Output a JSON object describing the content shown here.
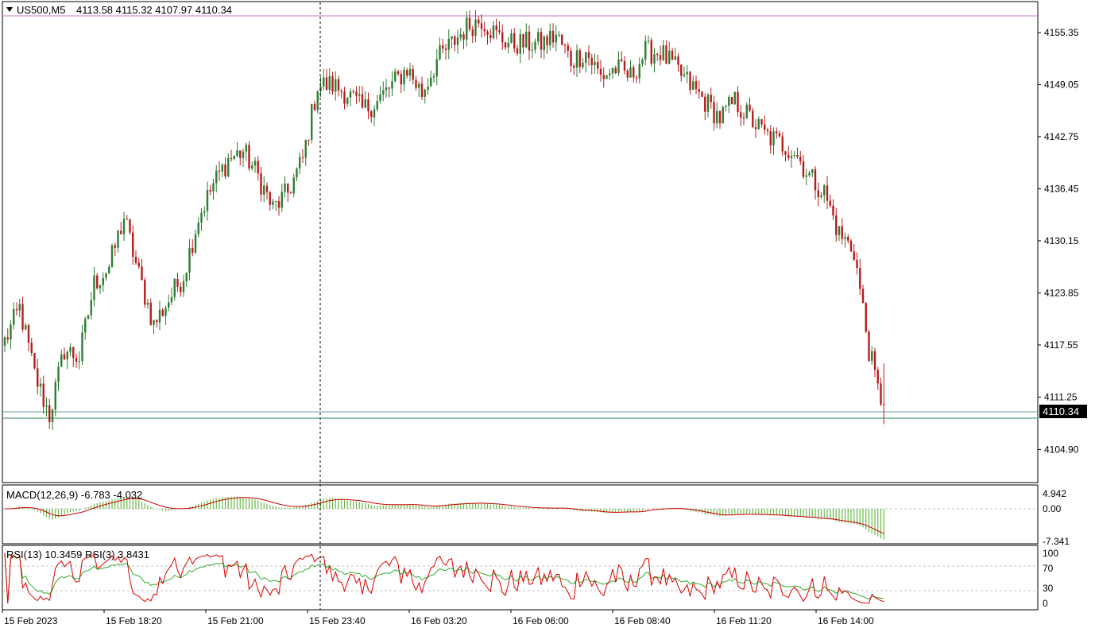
{
  "header": {
    "symbol": "US500,M5",
    "ohlc": "4113.58 4115.32 4107.97 4110.34"
  },
  "price_axis": {
    "ticks": [
      "4155.35",
      "4149.05",
      "4142.75",
      "4136.45",
      "4130.15",
      "4123.85",
      "4117.55",
      "4111.25",
      "4104.90"
    ],
    "current_price": "4110.34"
  },
  "time_axis": {
    "labels": [
      "15 Feb 2023",
      "15 Feb 18:20",
      "15 Feb 21:00",
      "15 Feb 23:40",
      "16 Feb 03:20",
      "16 Feb 06:00",
      "16 Feb 08:40",
      "16 Feb 11:20",
      "16 Feb 14:00"
    ]
  },
  "macd_panel": {
    "label": "MACD(12,26,9) -6.783 -4.032",
    "ticks": [
      "4.942",
      "0.00",
      "-7.341"
    ]
  },
  "rsi_panel": {
    "label": "RSI(13) 10.3459  RSI(3) 3.8431",
    "ticks": [
      "100",
      "70",
      "30",
      "0"
    ]
  },
  "colors": {
    "bull": "#2e7d32",
    "bear": "#b71c1c",
    "price_line": "#2e8b57",
    "top_line": "#c080c0",
    "macd_hist": "#66bb44",
    "signal": "#cc0000",
    "rsi_slow": "#33aa33",
    "rsi_fast": "#dd0000"
  },
  "chart_data": [
    {
      "type": "candlestick",
      "symbol": "US500",
      "timeframe": "M5",
      "ylim": [
        4101,
        4159
      ],
      "price_anchors": [
        [
          0,
          4118
        ],
        [
          5,
          4122
        ],
        [
          10,
          4114
        ],
        [
          15,
          4109
        ],
        [
          20,
          4117
        ],
        [
          25,
          4116
        ],
        [
          30,
          4125
        ],
        [
          35,
          4127
        ],
        [
          40,
          4133
        ],
        [
          45,
          4126
        ],
        [
          50,
          4120
        ],
        [
          55,
          4123
        ],
        [
          60,
          4126
        ],
        [
          65,
          4133
        ],
        [
          70,
          4137
        ],
        [
          75,
          4140
        ],
        [
          80,
          4141
        ],
        [
          85,
          4138
        ],
        [
          90,
          4134
        ],
        [
          95,
          4136
        ],
        [
          100,
          4140
        ],
        [
          105,
          4149
        ],
        [
          110,
          4149
        ],
        [
          115,
          4148
        ],
        [
          120,
          4146
        ],
        [
          125,
          4147
        ],
        [
          130,
          4149
        ],
        [
          135,
          4151
        ],
        [
          140,
          4148
        ],
        [
          145,
          4152
        ],
        [
          150,
          4154
        ],
        [
          155,
          4156
        ],
        [
          160,
          4157
        ],
        [
          165,
          4155
        ],
        [
          170,
          4154
        ],
        [
          175,
          4154
        ],
        [
          180,
          4154
        ],
        [
          185,
          4155
        ],
        [
          190,
          4152
        ],
        [
          195,
          4153
        ],
        [
          200,
          4150
        ],
        [
          205,
          4151
        ],
        [
          210,
          4150
        ],
        [
          215,
          4153
        ],
        [
          220,
          4153
        ],
        [
          225,
          4151
        ],
        [
          230,
          4149
        ],
        [
          235,
          4147
        ],
        [
          240,
          4145
        ],
        [
          245,
          4147
        ],
        [
          250,
          4145
        ],
        [
          255,
          4143
        ],
        [
          260,
          4142
        ],
        [
          265,
          4141
        ],
        [
          270,
          4138
        ],
        [
          275,
          4136
        ],
        [
          280,
          4131
        ],
        [
          285,
          4129
        ],
        [
          290,
          4117
        ],
        [
          293,
          4112
        ],
        [
          295,
          4110.34
        ]
      ]
    },
    {
      "type": "bar",
      "name": "MACD(12,26,9)",
      "macd": -6.783,
      "signal": -4.032,
      "ylim": [
        -7.341,
        4.942
      ]
    },
    {
      "type": "line",
      "series": [
        {
          "name": "RSI(13)",
          "last": 10.3459
        },
        {
          "name": "RSI(3)",
          "last": 3.8431
        }
      ],
      "levels": [
        30,
        70
      ],
      "ylim": [
        0,
        100
      ]
    }
  ]
}
